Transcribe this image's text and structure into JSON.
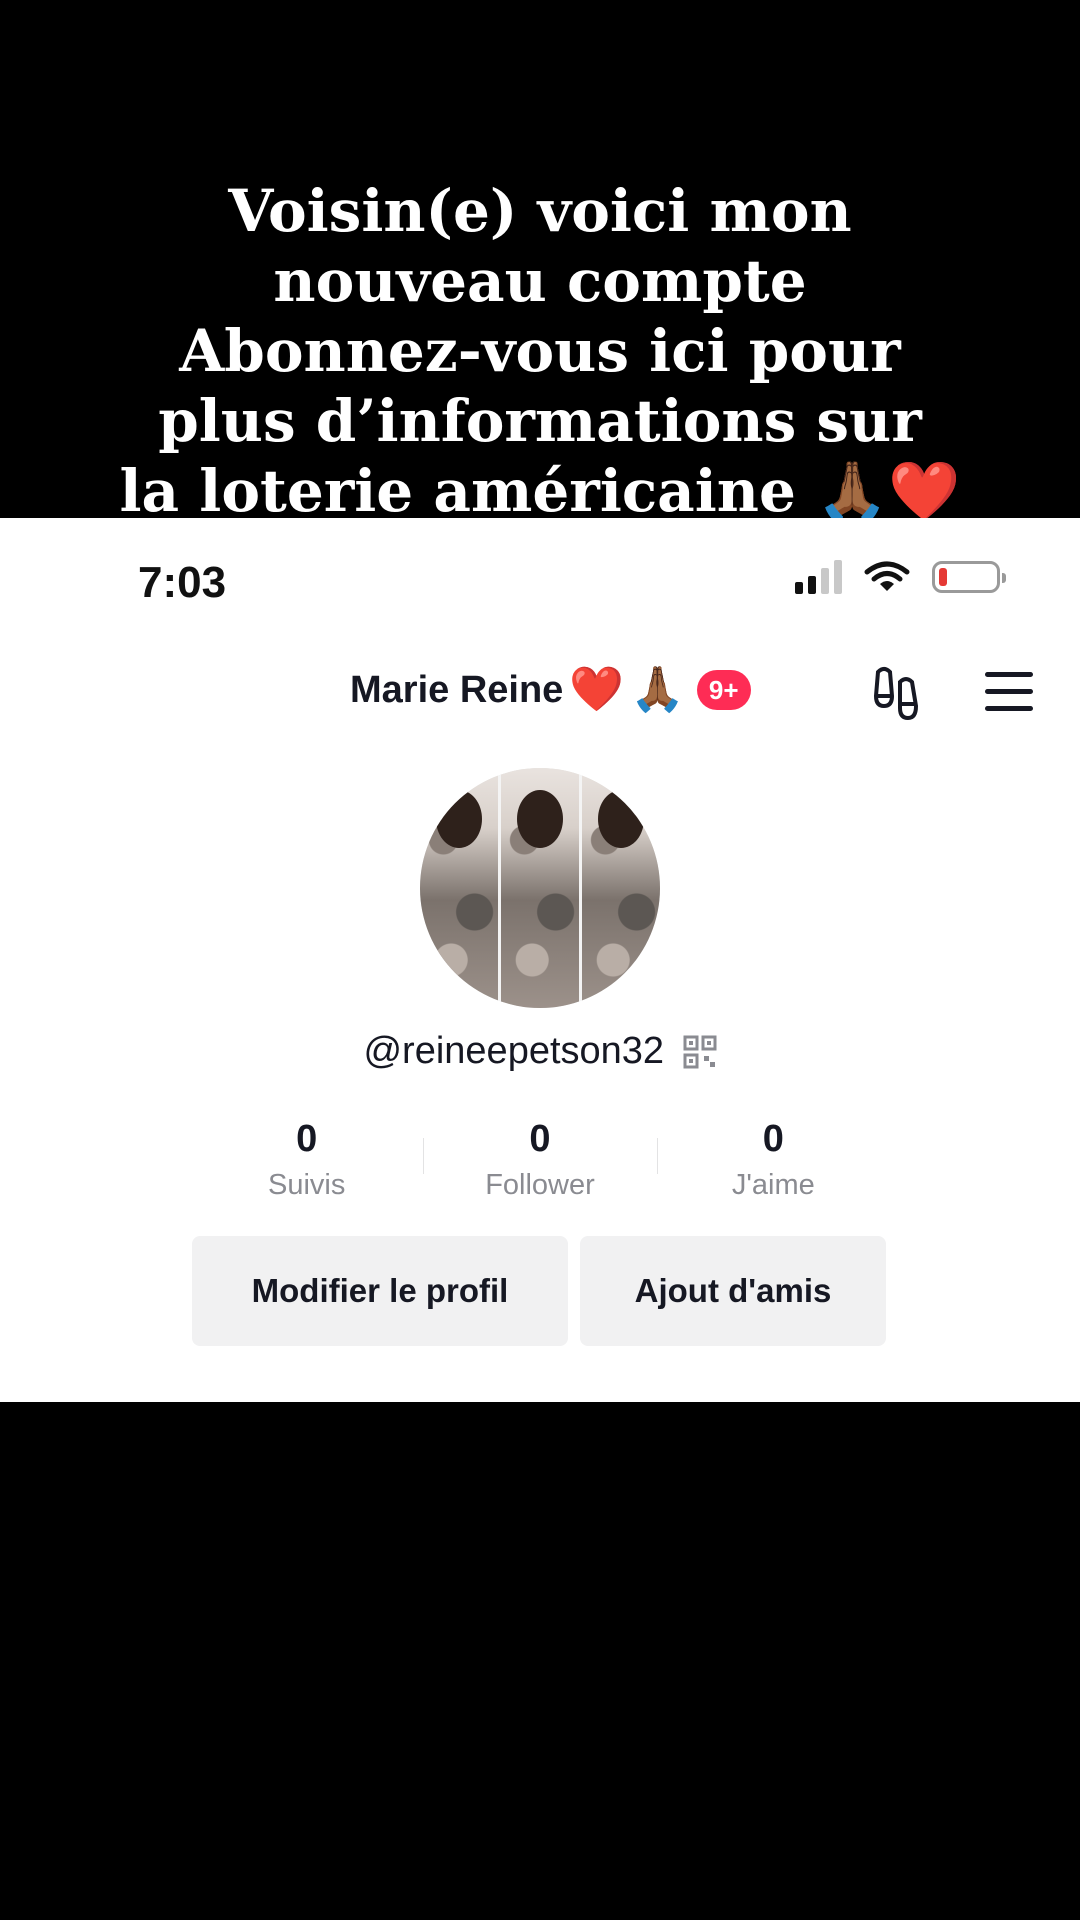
{
  "caption": {
    "lines": [
      "Voisin(e)  voici mon",
      "nouveau compte",
      "Abonnez-vous ici pour",
      "plus d’informations sur",
      "la loterie américaine 🙏🏾❤️"
    ]
  },
  "status_bar": {
    "time": "7:03",
    "battery_level": 0.15,
    "battery_color": "#e53935"
  },
  "profile": {
    "display_name": "Marie Reine",
    "name_emoji_1": "❤️",
    "name_emoji_2": "🙏🏾",
    "notification_badge": "9+",
    "handle": "@reineepetson32",
    "icons": [
      "footprint-icon",
      "menu-icon",
      "qr-code-icon"
    ]
  },
  "stats": [
    {
      "value": "0",
      "label": "Suivis"
    },
    {
      "value": "0",
      "label": "Follower"
    },
    {
      "value": "0",
      "label": "J'aime"
    }
  ],
  "actions": {
    "edit_profile": "Modifier le profil",
    "add_friends": "Ajout d'amis"
  },
  "colors": {
    "badge": "#fe2c55",
    "button_bg": "#f1f1f2",
    "text": "#161823",
    "muted": "#8a8b91"
  }
}
